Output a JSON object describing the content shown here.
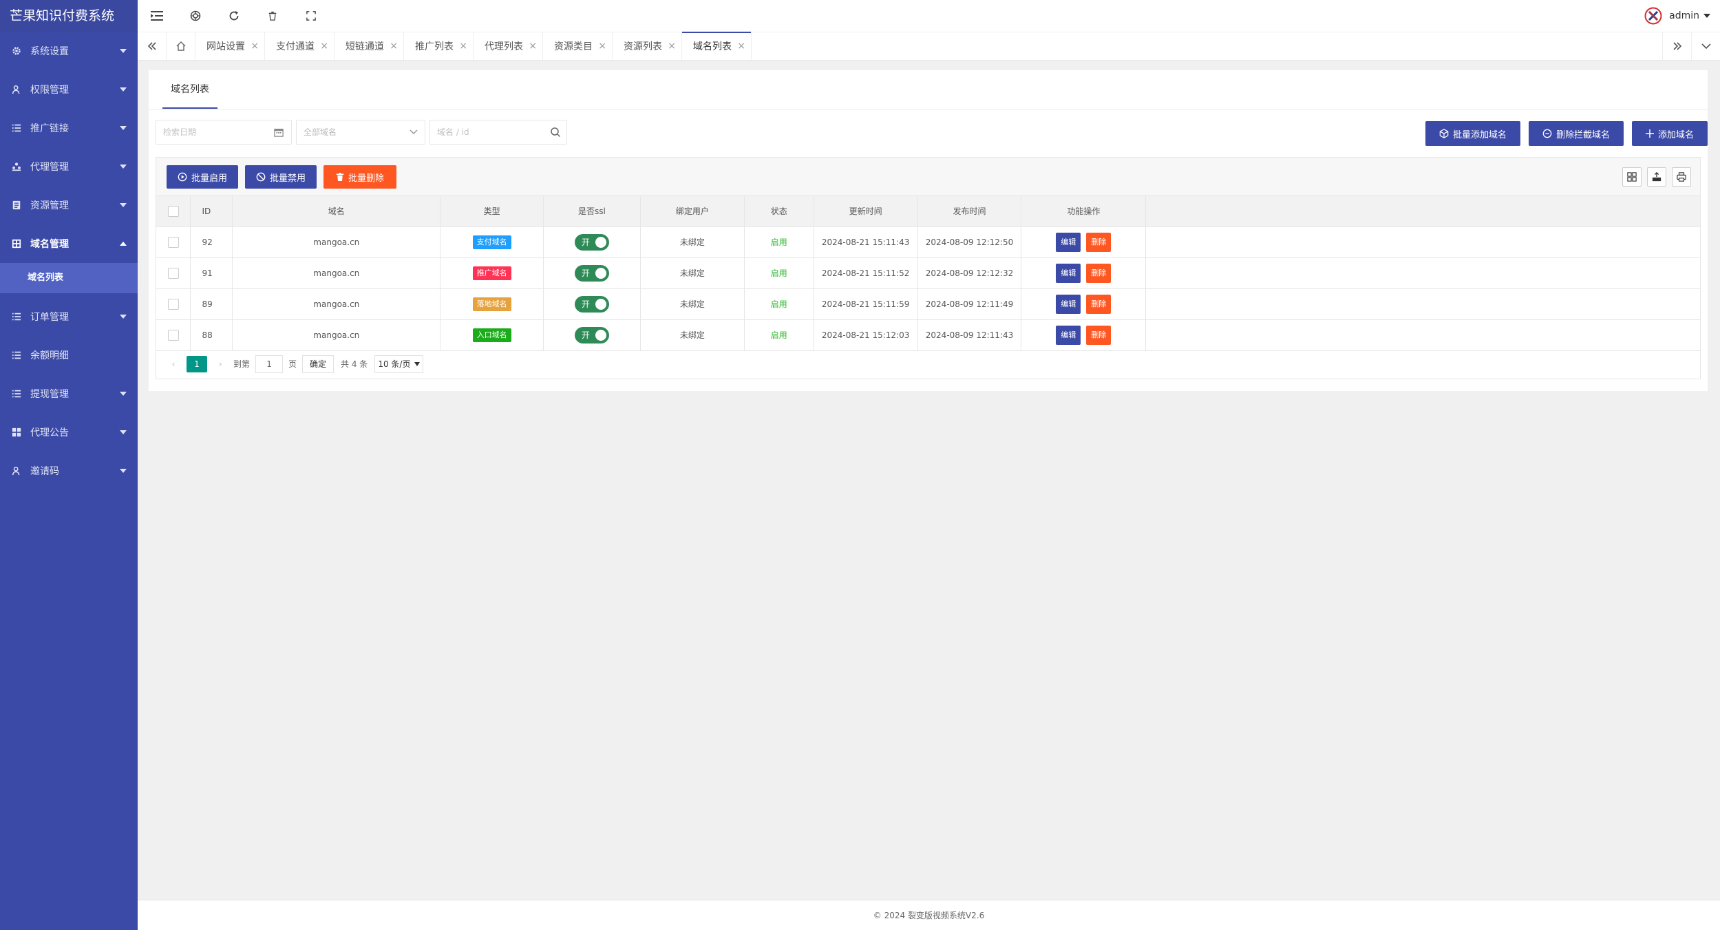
{
  "app": {
    "title": "芒果知识付费系统"
  },
  "sidebar": {
    "items": [
      {
        "label": "系统设置",
        "icon": "gear-icon"
      },
      {
        "label": "权限管理",
        "icon": "user-icon"
      },
      {
        "label": "推广链接",
        "icon": "list-icon"
      },
      {
        "label": "代理管理",
        "icon": "group-icon"
      },
      {
        "label": "资源管理",
        "icon": "file-icon"
      },
      {
        "label": "域名管理",
        "icon": "table-icon",
        "open": true,
        "children": [
          {
            "label": "域名列表",
            "active": true
          }
        ]
      },
      {
        "label": "订单管理",
        "icon": "list-icon"
      },
      {
        "label": "余额明细",
        "icon": "list-icon"
      },
      {
        "label": "提现管理",
        "icon": "list-icon"
      },
      {
        "label": "代理公告",
        "icon": "grid-icon"
      },
      {
        "label": "邀请码",
        "icon": "user-icon"
      }
    ]
  },
  "header": {
    "user": "admin"
  },
  "tabs": [
    {
      "label": "网站设置"
    },
    {
      "label": "支付通道"
    },
    {
      "label": "短链通道"
    },
    {
      "label": "推广列表"
    },
    {
      "label": "代理列表"
    },
    {
      "label": "资源类目"
    },
    {
      "label": "资源列表"
    },
    {
      "label": "域名列表",
      "active": true
    }
  ],
  "card": {
    "tab_label": "域名列表"
  },
  "search": {
    "date_placeholder": "检索日期",
    "select_value": "全部域名",
    "keyword_placeholder": "域名 / id"
  },
  "actions": {
    "batch_add": "批量添加域名",
    "delete_blocked": "删除拦截域名",
    "add": "添加域名",
    "batch_enable": "批量启用",
    "batch_disable": "批量禁用",
    "batch_delete": "批量删除"
  },
  "table": {
    "headers": [
      "ID",
      "域名",
      "类型",
      "是否ssl",
      "绑定用户",
      "状态",
      "更新时间",
      "发布时间",
      "功能操作"
    ],
    "rows": [
      {
        "id": "92",
        "domain": "mangoa.cn",
        "type": "支付域名",
        "type_color": "#1e9fff",
        "ssl": "开",
        "user": "未绑定",
        "status": "启用",
        "updated": "2024-08-21 15:11:43",
        "published": "2024-08-09 12:12:50",
        "edit": "编辑",
        "del": "删除"
      },
      {
        "id": "91",
        "domain": "mangoa.cn",
        "type": "推广域名",
        "type_color": "#ff3355",
        "ssl": "开",
        "user": "未绑定",
        "status": "启用",
        "updated": "2024-08-21 15:11:52",
        "published": "2024-08-09 12:12:32",
        "edit": "编辑",
        "del": "删除"
      },
      {
        "id": "89",
        "domain": "mangoa.cn",
        "type": "落地域名",
        "type_color": "#e6a23c",
        "ssl": "开",
        "user": "未绑定",
        "status": "启用",
        "updated": "2024-08-21 15:11:59",
        "published": "2024-08-09 12:11:49",
        "edit": "编辑",
        "del": "删除"
      },
      {
        "id": "88",
        "domain": "mangoa.cn",
        "type": "入口域名",
        "type_color": "#1aad19",
        "ssl": "开",
        "user": "未绑定",
        "status": "启用",
        "updated": "2024-08-21 15:12:03",
        "published": "2024-08-09 12:11:43",
        "edit": "编辑",
        "del": "删除"
      }
    ]
  },
  "pager": {
    "current": "1",
    "goto_label": "到第",
    "goto_value": "1",
    "page_unit": "页",
    "confirm": "确定",
    "total": "共 4 条",
    "per_page": "10 条/页"
  },
  "footer": {
    "text": "© 2024 裂变版视频系统V2.6"
  },
  "colors": {
    "primary": "#3b4aa6",
    "danger": "#ff5722",
    "success": "#2eb82e",
    "pager_active": "#009688"
  }
}
